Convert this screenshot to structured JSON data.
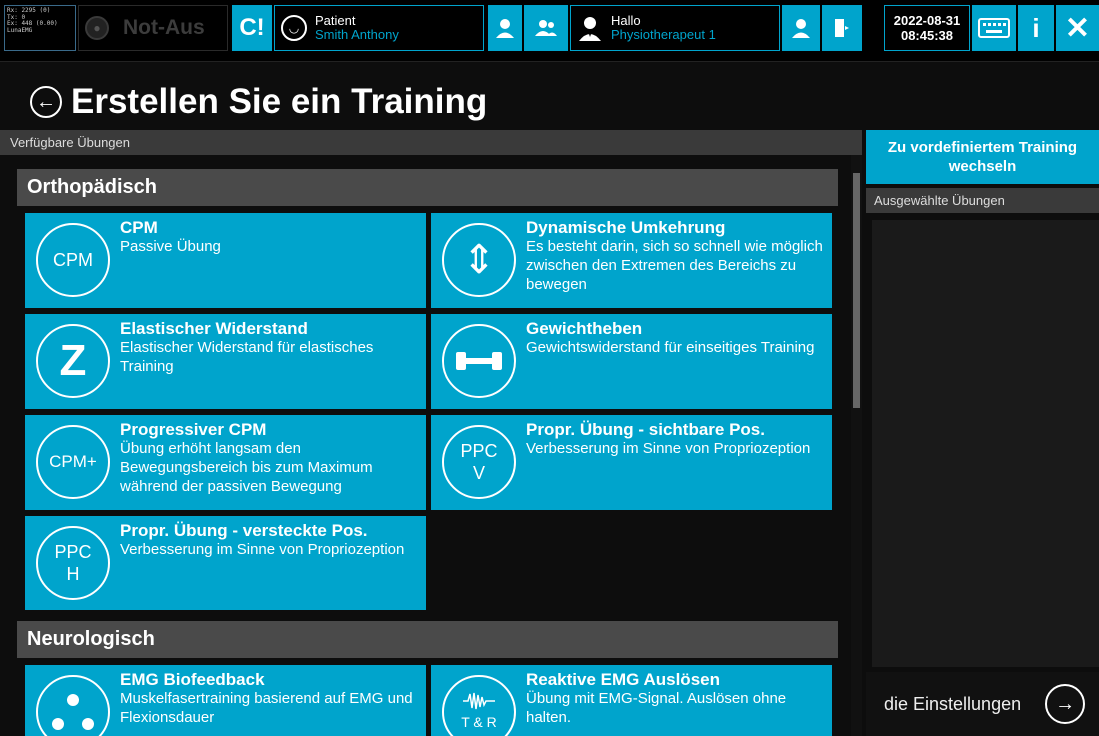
{
  "topbar": {
    "debug_lines": [
      "Rx: 2295 (0)",
      "Tx: 0",
      "Ex: 448 (0.00)",
      "LunaEMG"
    ],
    "notaus_label": "Not-Aus",
    "connect_glyph": "C!",
    "patient_label": "Patient",
    "patient_name": "Smith Anthony",
    "hallo_label": "Hallo",
    "hallo_name": "Physiotherapeut 1",
    "date": "2022-08-31",
    "time": "08:45:38",
    "info_glyph": "i",
    "close_glyph": "✕"
  },
  "page": {
    "back_glyph": "←",
    "title": "Erstellen Sie ein Training"
  },
  "left": {
    "header": "Verfügbare Übungen",
    "categories": [
      "Orthopädisch",
      "Neurologisch"
    ],
    "cards": [
      {
        "title": "CPM",
        "desc": "Passive Übung",
        "icon_text": "CPM"
      },
      {
        "title": "Dynamische Umkehrung",
        "desc": "Es besteht darin, sich so schnell wie möglich zwischen den Extremen des Bereichs zu bewegen",
        "icon_text": "⇕"
      },
      {
        "title": "Elastischer Widerstand",
        "desc": "Elastischer Widerstand für elastisches Training",
        "icon_text": "Z"
      },
      {
        "title": "Gewichtheben",
        "desc": "Gewichtswiderstand für einseitiges Training",
        "icon_text": ""
      },
      {
        "title": "Progressiver CPM",
        "desc": "Übung erhöht langsam den Bewegungsbereich bis zum Maximum während der passiven Bewegung",
        "icon_text": "CPM+"
      },
      {
        "title": "Propr. Übung - sichtbare Pos.",
        "desc": "Verbesserung im Sinne von Propriozeption",
        "icon_text": "PPC\nV"
      },
      {
        "title": "Propr. Übung - versteckte Pos.",
        "desc": "Verbesserung im Sinne von Propriozeption",
        "icon_text": "PPC\nH"
      },
      {
        "title": "EMG Biofeedback",
        "desc": "Muskelfasertraining basierend auf EMG und Flexionsdauer",
        "icon_text": ""
      },
      {
        "title": "Reaktive EMG Auslösen",
        "desc": "Übung mit EMG-Signal. Auslösen ohne halten.",
        "icon_text": "T & R"
      }
    ]
  },
  "right": {
    "switch_button": "Zu vordefiniertem Training wechseln",
    "header": "Ausgewählte Übungen",
    "settings_label": "die Einstellungen",
    "settings_arrow": "→"
  },
  "colors": {
    "accent": "#00a4cc",
    "background": "#0d0d0d",
    "category_bar": "#4a4a4a"
  }
}
